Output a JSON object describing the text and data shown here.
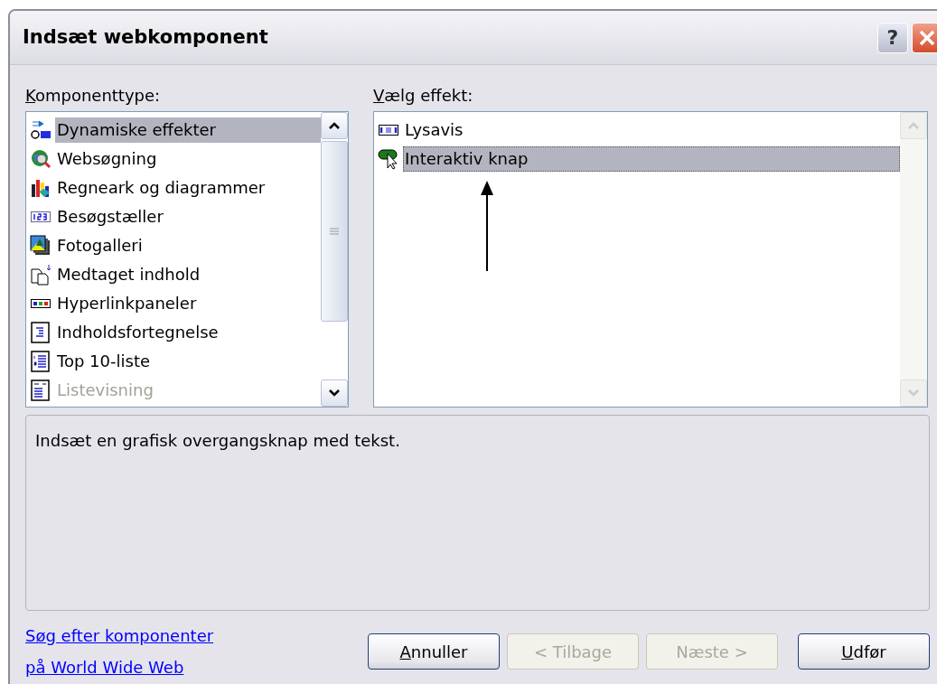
{
  "window": {
    "title": "Indsæt webkomponent",
    "help_button": "?"
  },
  "component_types": {
    "label": "Komponenttype:",
    "mnemonic_first": true,
    "items": [
      {
        "label": "Dynamiske effekter",
        "selected": true,
        "disabled": false
      },
      {
        "label": "Websøgning",
        "selected": false,
        "disabled": false
      },
      {
        "label": "Regneark og diagrammer",
        "selected": false,
        "disabled": false
      },
      {
        "label": "Besøgstæller",
        "selected": false,
        "disabled": false
      },
      {
        "label": "Fotogalleri",
        "selected": false,
        "disabled": false
      },
      {
        "label": "Medtaget indhold",
        "selected": false,
        "disabled": false
      },
      {
        "label": "Hyperlinkpaneler",
        "selected": false,
        "disabled": false
      },
      {
        "label": "Indholdsfortegnelse",
        "selected": false,
        "disabled": false
      },
      {
        "label": "Top 10-liste",
        "selected": false,
        "disabled": false
      },
      {
        "label": "Listevisning",
        "selected": false,
        "disabled": true
      }
    ]
  },
  "effects": {
    "label": "Vælg effekt:",
    "mnemonic_first": true,
    "items": [
      {
        "label": "Lysavis",
        "selected": false
      },
      {
        "label": "Interaktiv knap",
        "selected": true
      }
    ]
  },
  "description": "Indsæt en grafisk overgangsknap med tekst.",
  "links": [
    "Søg efter komponenter",
    "på World Wide Web"
  ],
  "buttons": [
    {
      "label": "Annuller",
      "disabled": false,
      "mnemonic_first": true
    },
    {
      "label": "< Tilbage",
      "disabled": true,
      "mnemonic_first": false
    },
    {
      "label": "Næste >",
      "disabled": true,
      "mnemonic_first": false
    },
    {
      "label": "Udfør",
      "disabled": false,
      "mnemonic_first": true
    }
  ]
}
